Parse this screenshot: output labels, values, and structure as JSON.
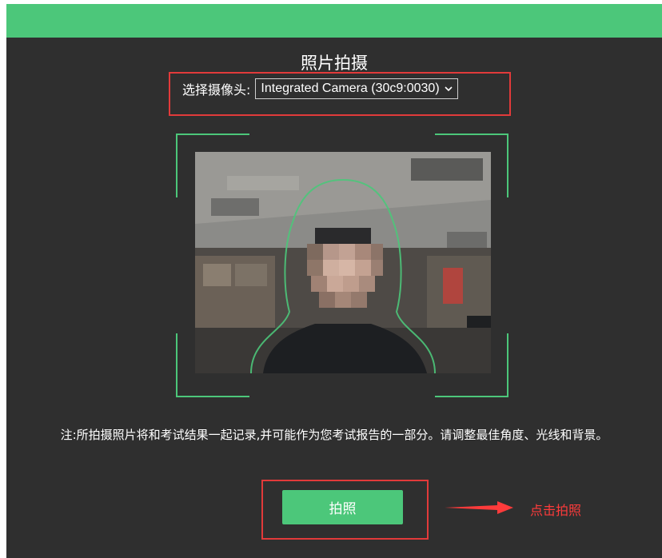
{
  "page": {
    "title": "照片拍摄",
    "camera_label": "选择摄像头:",
    "camera_selected": "Integrated Camera (30c9:0030)",
    "note": "注:所拍摄照片将和考试结果一起记录,并可能作为您考试报告的一部分。请调整最佳角度、光线和背景。",
    "shoot_button": "拍照",
    "hint": "点击拍照"
  },
  "colors": {
    "accent_green": "#4cc77a",
    "panel_bg": "#2f2f2f",
    "annotation_red": "#e23a3a"
  },
  "icons": {
    "select_chevron": "chevron-down-icon",
    "arrow": "arrow-right-icon"
  }
}
